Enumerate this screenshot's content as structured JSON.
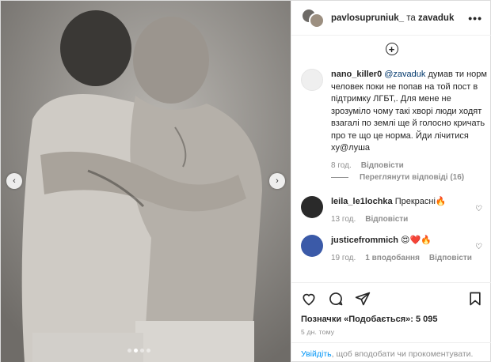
{
  "header": {
    "owner_user": "pavlosupruniuk_",
    "and_text": " та ",
    "collab_user": "zavaduk",
    "more_label": "•••"
  },
  "add_button": "+",
  "comments": [
    {
      "user": "nano_killer0",
      "mention": "@zavaduk",
      "text": " думав ти норм человек поки не попав на той пост в підтримку ЛГБТ,. Для мене не зрозуміло чому такі хворі люди ходят взагалі по землі ще й голосно кричать про те що це норма. Йди лічитися ху@луша",
      "age": "8 год.",
      "reply": "Відповісти",
      "view_replies": "Переглянути відповіді (16)"
    },
    {
      "user": "leila_le1lochka",
      "text": " Прекрасні🔥",
      "age": "13 год.",
      "reply": "Відповісти"
    },
    {
      "user": "justicefrommich",
      "text": " 😍❤️🔥",
      "age": "19 год.",
      "likes": "1 вподобання",
      "reply": "Відповісти"
    }
  ],
  "photo": {
    "nav_prev": "‹",
    "nav_next": "›"
  },
  "footer": {
    "likes_text": "Позначки «Подобається»: 5 095",
    "time_text": "5 дн. тому",
    "login_link": "Увійдіть",
    "login_rest": ", щоб вподобати чи прокоментувати."
  }
}
